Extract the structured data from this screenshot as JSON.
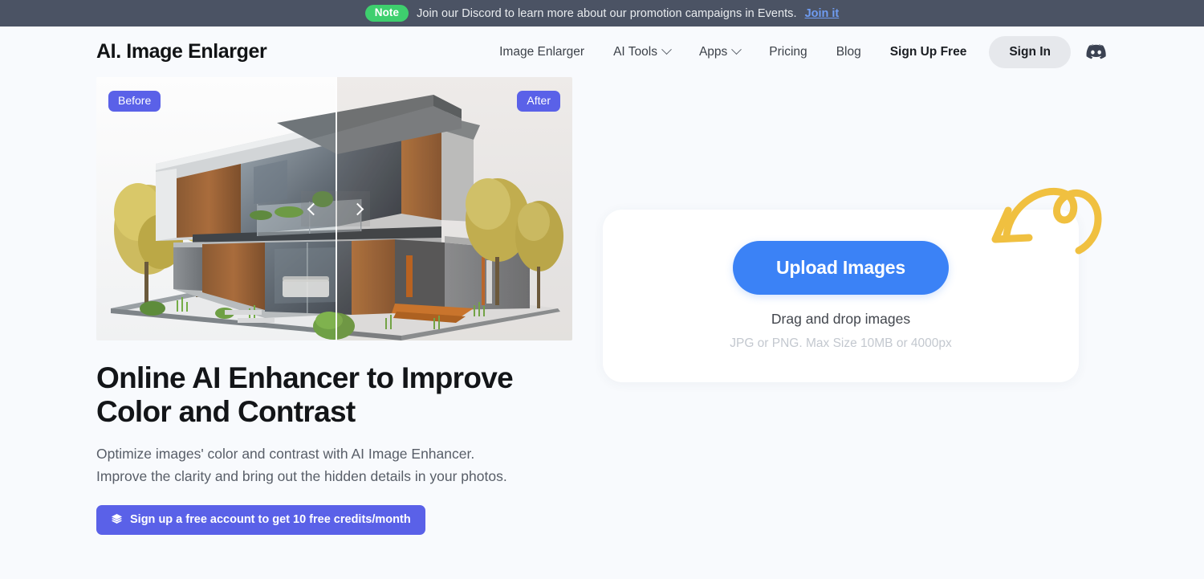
{
  "notice": {
    "badge": "Note",
    "text": "Join our Discord to learn more about our promotion campaigns in Events.",
    "link": "Join it",
    "badge_color": "#3ecf6e",
    "bar_color": "#4b5364",
    "link_color": "#6f9cf2"
  },
  "header": {
    "brand": "AI. Image Enlarger",
    "nav": [
      {
        "label": "Image Enlarger",
        "has_caret": false
      },
      {
        "label": "AI Tools",
        "has_caret": true
      },
      {
        "label": "Apps",
        "has_caret": true
      },
      {
        "label": "Pricing",
        "has_caret": false
      },
      {
        "label": "Blog",
        "has_caret": false
      },
      {
        "label": "Sign Up Free",
        "has_caret": false
      }
    ],
    "sign_in": "Sign In",
    "discord_icon": "discord-icon"
  },
  "hero": {
    "before_label": "Before",
    "after_label": "After",
    "slider_position_percent": 50,
    "headline": "Online AI Enhancer to Improve Color and Contrast",
    "subcopy_line1": "Optimize images' color and contrast with AI Image Enhancer.",
    "subcopy_line2": "Improve the clarity and bring out the hidden details in your photos.",
    "credits_button": "Sign up a free account to get 10 free credits/month",
    "credits_icon": "layers-icon",
    "accent_color": "#5a61e8"
  },
  "upload": {
    "button": "Upload Images",
    "drag_text": "Drag and drop images",
    "limits": "JPG or PNG. Max Size 10MB or 4000px",
    "button_color": "#3b82f6",
    "arrow_color": "#f0c040",
    "arrow_icon": "curly-arrow-icon"
  }
}
